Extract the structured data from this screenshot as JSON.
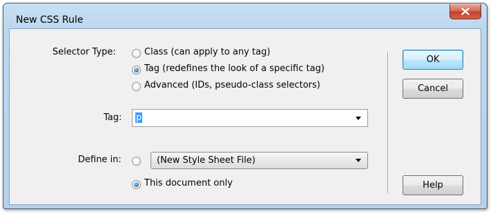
{
  "window": {
    "title": "New CSS Rule"
  },
  "selector_type": {
    "label": "Selector Type:",
    "options": [
      {
        "label": "Class (can apply to any tag)",
        "checked": false
      },
      {
        "label": "Tag (redefines the look of a specific tag)",
        "checked": true
      },
      {
        "label": "Advanced (IDs, pseudo-class selectors)",
        "checked": false
      }
    ]
  },
  "tag": {
    "label": "Tag:",
    "value": "p"
  },
  "define_in": {
    "label": "Define in:",
    "new_file_option": "(New Style Sheet File)",
    "new_file_checked": false,
    "this_doc_label": "This document only",
    "this_doc_checked": true
  },
  "buttons": {
    "ok": "OK",
    "cancel": "Cancel",
    "help": "Help"
  },
  "colors": {
    "selection": "#3399ff",
    "close_button": "#c2412b",
    "radio_checked": "#2e7fc6"
  }
}
